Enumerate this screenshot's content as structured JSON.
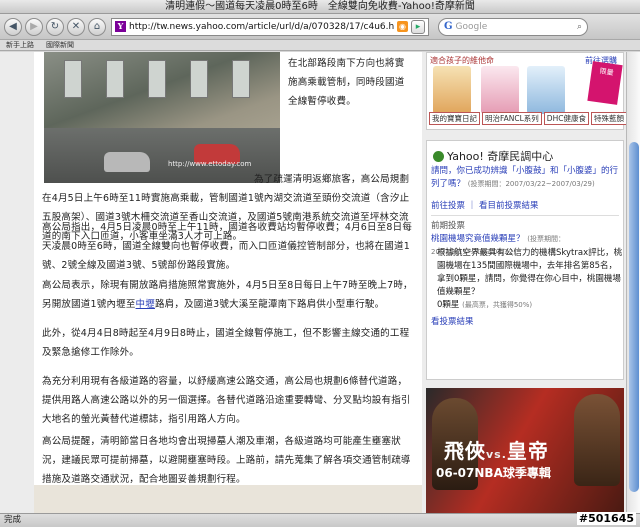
{
  "window": {
    "title": "清明連假～國道每天凌晨0時至6時　全線雙向免收費-Yahoo!奇摩新聞"
  },
  "toolbar": {
    "back_icon": "back-arrow-icon",
    "forward_icon": "forward-arrow-icon",
    "url": "http://tw.news.yahoo.com/article/url/d/a/070328/17/c4u6.html",
    "search_placeholder": "Google"
  },
  "bookmarks": [
    "新手上路",
    "國際新聞"
  ],
  "article": {
    "photo_watermark": "http://www.ettoday.com",
    "p1": "在北部路段南下方向也將實施高乘載管制，同時段國道全線暫停收費。",
    "p2": "為了疏運清明返鄉旅客，高公局規劃在4月5日上午6時至11時實施高乘載，管制國道1號內湖交流道至頭份交流道（含汐止五股高架）、國道3號木柵交流道至香山交流道，及國道5號南港系統交流道至坪林交流道的南下入口匝道，小客車坐滿3人才可上路。",
    "p3": "高公局指出，4月5日凌晨0時至上午11時，國道各收費站均暫停收費；4月6日至8日每天凌晨0時至6時，國道全線雙向也暫停收費，而入口匝道儀控管制部分，也將在國道1號、2號全線及國道3號、5號部份路段實施。",
    "p4_before": "高公局表示，除現有開放路肩措施照常實施外，4月5日至8日每日上午7時至晚上7時，另開放國道1號內壢至",
    "p4_link": "中壢",
    "p4_after": "路肩，及國道3號大溪至龍潭南下路肩供小型車行駛。",
    "p5": "此外，從4月4日8時起至4月9日8時止，國道全線暫停施工，但不影響主線交通的工程及緊急搶修工作除外。",
    "p6": "為充分利用現有各級道路的容量，以紓緩高速公路交通，高公局也規劃6條替代道路，提供用路人高速公路以外的另一個選擇。各替代道路沿途重要轉彎、分叉點均設有指引大地名的螢光黃替代道標誌，指引用路人方向。",
    "p7": "高公局提醒，清明節當日各地均會出現掃墓人潮及車潮，各級道路均可能產生壅塞狀況，建議民眾可提前掃墓，以避開壅塞時段。上路前，請先蒐集了解各項交通管制疏導措施及道路交通狀況，配合地圖妥善規劃行程。"
  },
  "ad_top": {
    "headline": "適合孩子的維他命",
    "link": "前往選購",
    "ribbon": "限量",
    "labels": [
      "我的寶寶日記",
      "明治FANCL系列",
      "DHC健康食",
      "特殊藍顏"
    ]
  },
  "poll": {
    "title": "Yahoo! 奇摩民調中心",
    "question1": "請問，你已成功辨識「小腹鼓」和「小腹婆」的行列了嗎？",
    "question1_meta": "(投票期間：2007/03/22~2007/03/29)",
    "link_vote": "前往投票",
    "link_results": "看目前投票結果",
    "section_label": "前期投票",
    "question2_title": "桃園機場究竟值幾顆星？",
    "question2_meta": "(投票期間：2007/3/15~2007/03/22)",
    "question2_body": "根據航空界最具有公信力的機構Skytrax評比，桃園機場在135間國際機場中，去年排名第85名，拿到0顆星，請問，你覺得在你心目中，桃園機場值幾顆星？",
    "result_value": "0顆星",
    "result_meta": "(最高票，共獲得50%)",
    "result_link": "看投票結果"
  },
  "ad_nba": {
    "title_a": "飛俠",
    "title_vs": "vs.",
    "title_b": "皇帝",
    "subtitle": "06-07NBA球季專輯"
  },
  "status": {
    "text": "完成"
  },
  "watermark": "#501645"
}
